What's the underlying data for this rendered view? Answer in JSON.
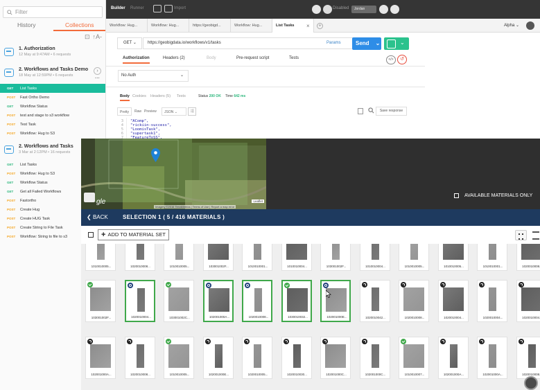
{
  "sidebar": {
    "filter_placeholder": "Filter",
    "tabs": [
      {
        "label": "History"
      },
      {
        "label": "Collections"
      }
    ],
    "sort_label": "↑A-",
    "collections": [
      {
        "name": "1. Authorization",
        "meta": "12 May at 9:47AM  •  6 requests"
      },
      {
        "name": "2. Workflows and Tasks Demo",
        "meta": "18 May at 12:59PM  •  6 requests"
      },
      {
        "name": "2. Workflows and Tasks",
        "meta": "3 Mar at 2:12PM  •  16 requests"
      }
    ],
    "demo_requests": [
      {
        "method": "GET",
        "label": "List Tasks"
      },
      {
        "method": "POST",
        "label": "Fast Ortho Demo"
      },
      {
        "method": "GET",
        "label": "Workflow Status"
      },
      {
        "method": "POST",
        "label": "test and stage to s3 workflow"
      },
      {
        "method": "POST",
        "label": "Test Task"
      },
      {
        "method": "POST",
        "label": "Workflow: Hug to S3"
      }
    ],
    "tasks_requests": [
      {
        "method": "GET",
        "label": "List Tasks"
      },
      {
        "method": "POST",
        "label": "Workflow: Hug to S3"
      },
      {
        "method": "GET",
        "label": "Workflow Status"
      },
      {
        "method": "GET",
        "label": "Get all Failed Workflows"
      },
      {
        "method": "POST",
        "label": "Fastortho"
      },
      {
        "method": "POST",
        "label": "Create Hug"
      },
      {
        "method": "POST",
        "label": "Create HUG Task"
      },
      {
        "method": "POST",
        "label": "Create String to File Task"
      },
      {
        "method": "POST",
        "label": "Workflow: String to file to s3"
      }
    ]
  },
  "topbar": {
    "builder": "Builder",
    "runner": "Runner",
    "import": "Import",
    "sync": "Disabled",
    "user": "Jordan"
  },
  "request_tabs": [
    "Workflow: Hug...",
    "Workflow: Hug...",
    "https://geobigd...",
    "Workflow: Hug...",
    "List Tasks"
  ],
  "environment": "Alpha",
  "request": {
    "method": "GET",
    "url": "https://geobigdata.io/workflows/v1/tasks",
    "params_label": "Params",
    "send_label": "Send",
    "tabs": [
      "Authorization",
      "Headers (2)",
      "Body",
      "Pre-request script",
      "Tests"
    ],
    "auth_type": "No Auth"
  },
  "response": {
    "tabs": [
      "Body",
      "Cookies",
      "Headers (5)",
      "Tests"
    ],
    "status_label": "Status",
    "status_value": "200 OK",
    "time_label": "Time",
    "time_value": "642 ms",
    "view_buttons": [
      "Pretty",
      "Raw",
      "Preview"
    ],
    "format": "JSON",
    "save_label": "Save response",
    "lines": [
      {
        "num": "3",
        "text": "\"AComp\","
      },
      {
        "num": "4",
        "text": "\"rickiin-success\","
      },
      {
        "num": "5",
        "text": "\"LoomisTask\","
      },
      {
        "num": "6",
        "text": "\"supertask1\","
      },
      {
        "num": "7",
        "text": "\"FeatureToSS\","
      }
    ]
  },
  "catalog": {
    "map_leaflet": "Leaflet",
    "map_attribution": "Imagery ©2016 TerraMetrics | Terms of Use | Report a map error",
    "map_logo": "gle",
    "available_only": "AVAILABLE MATERIALS ONLY",
    "back_label": "BACK",
    "selection_title": "SELECTION 1 ( 5 / 416 MATERIALS )",
    "add_to_set": "ADD TO MATERIAL SET",
    "row1": [
      "1010010005...",
      "1020010008...",
      "1010010005...",
      "103001002F...",
      "1010010001...",
      "1010010004...",
      "103001002F...",
      "1010010004...",
      "1010010005...",
      "1010010005...",
      "1010010001...",
      "1020010008..."
    ],
    "row2": [
      {
        "label": "103001002F...",
        "badge": "check",
        "selected": false
      },
      {
        "label": "1020010004...",
        "badge": "eye",
        "selected": true
      },
      {
        "label": "103001002C...",
        "badge": "check",
        "selected": false
      },
      {
        "label": "102001000A...",
        "badge": "eye",
        "selected": true
      },
      {
        "label": "1020010008...",
        "badge": "eye",
        "selected": true
      },
      {
        "label": "1030010032...",
        "badge": "check",
        "selected": true
      },
      {
        "label": "102001000E...",
        "badge": "eye",
        "selected": true
      },
      {
        "label": "1020010042...",
        "badge": "hist",
        "selected": false
      },
      {
        "label": "1020010008...",
        "badge": "hist",
        "selected": false
      },
      {
        "label": "1020010004...",
        "badge": "hist",
        "selected": false
      },
      {
        "label": "1020010004...",
        "badge": "hist",
        "selected": false
      },
      {
        "label": "1020010004...",
        "badge": "hist",
        "selected": false
      }
    ],
    "row3": [
      {
        "label": "102001000A...",
        "badge": "hist"
      },
      {
        "label": "1020010008...",
        "badge": "hist"
      },
      {
        "label": "1010010005...",
        "badge": "check"
      },
      {
        "label": "102001000E...",
        "badge": "hist"
      },
      {
        "label": "1020010005...",
        "badge": "hist"
      },
      {
        "label": "1020010030...",
        "badge": "hist"
      },
      {
        "label": "102001000C...",
        "badge": "hist"
      },
      {
        "label": "102001000C...",
        "badge": "hist"
      },
      {
        "label": "1010010007...",
        "badge": "check"
      },
      {
        "label": "102001000A...",
        "badge": "hist"
      },
      {
        "label": "102001000A...",
        "badge": "hist"
      },
      {
        "label": "1020010008...",
        "badge": "hist"
      }
    ]
  }
}
